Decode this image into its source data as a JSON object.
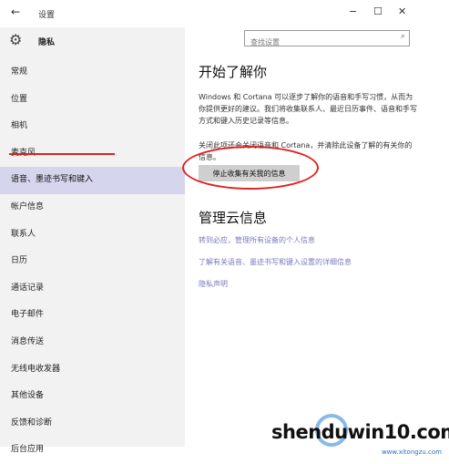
{
  "window": {
    "back_glyph": "←",
    "title": "设置",
    "minimize_glyph": "−",
    "maximize_glyph": "☐",
    "close_glyph": "✕"
  },
  "sidebar": {
    "gear_glyph": "⚙",
    "header": "隐私",
    "items": [
      {
        "label": "常规"
      },
      {
        "label": "位置"
      },
      {
        "label": "相机"
      },
      {
        "label": "麦克风"
      },
      {
        "label": "语音、墨迹书写和键入"
      },
      {
        "label": "帐户信息"
      },
      {
        "label": "联系人"
      },
      {
        "label": "日历"
      },
      {
        "label": "通话记录"
      },
      {
        "label": "电子邮件"
      },
      {
        "label": "消息传送"
      },
      {
        "label": "无线电收发器"
      },
      {
        "label": "其他设备"
      },
      {
        "label": "反馈和诊断"
      },
      {
        "label": "后台应用"
      }
    ],
    "selected_index": 4
  },
  "search": {
    "placeholder": "查找设置",
    "icon_glyph": "⌕"
  },
  "main": {
    "heading1": "开始了解你",
    "paragraph1": "Windows 和 Cortana 可以逐步了解你的语音和手写习惯，从而为你提供更好的建议。我们将收集联系人、最近日历事件、语音和手写方式和键入历史记录等信息。",
    "paragraph2": "关闭此项还会关闭语音和 Cortana，并清除此设备了解的有关你的信息。",
    "button_label": "停止收集有关我的信息",
    "heading2": "管理云信息",
    "links": [
      "转到必应，管理所有设备的个人信息",
      "了解有关语音、墨迹书写和键入设置的详细信息",
      "隐私声明"
    ]
  },
  "watermark": {
    "text": "shenduwin10.com",
    "sub": "www.xitongzu.com"
  },
  "colors": {
    "accent_red": "#e02020",
    "link": "#7a7ac0",
    "sidebar_bg": "#f2f2f2",
    "selected_bg": "#d5d5ee"
  }
}
